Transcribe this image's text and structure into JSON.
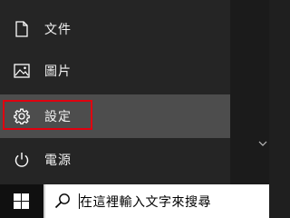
{
  "start_menu": {
    "items": [
      {
        "label": "文件",
        "icon": "document-icon"
      },
      {
        "label": "圖片",
        "icon": "picture-icon"
      },
      {
        "label": "設定",
        "icon": "gear-icon"
      },
      {
        "label": "電源",
        "icon": "power-icon"
      }
    ]
  },
  "taskbar": {
    "start_icon": "windows-logo-icon",
    "search": {
      "placeholder": "在這裡輸入文字來搜尋",
      "icon": "search-icon"
    }
  },
  "colors": {
    "highlight_border": "#e0000f",
    "hover_background": "#4d4d4d"
  }
}
